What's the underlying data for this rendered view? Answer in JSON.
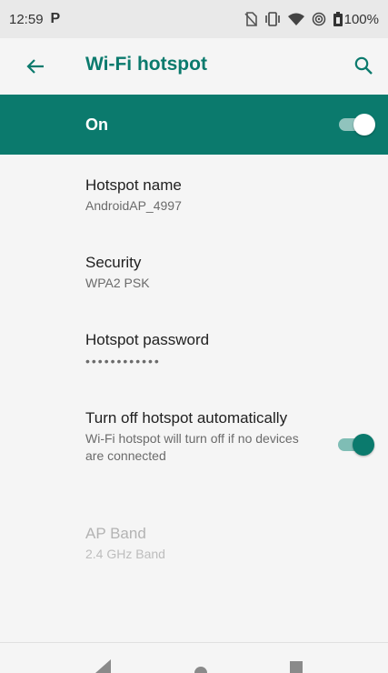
{
  "status_bar": {
    "time": "12:59",
    "notification_glyph": "P",
    "battery_text": "100%",
    "icons": [
      "no-sim-icon",
      "vibrate-icon",
      "wifi-icon",
      "hotspot-icon",
      "battery-icon"
    ]
  },
  "app_bar": {
    "title": "Wi-Fi hotspot",
    "back_icon": "arrow-back-icon",
    "search_icon": "search-icon"
  },
  "master_switch": {
    "label": "On",
    "checked": true
  },
  "preferences": {
    "hotspot_name": {
      "title": "Hotspot name",
      "summary": "AndroidAP_4997"
    },
    "security": {
      "title": "Security",
      "summary": "WPA2 PSK"
    },
    "password": {
      "title": "Hotspot password",
      "summary": "••••••••••••"
    },
    "auto_off": {
      "title": "Turn off hotspot automatically",
      "summary": "Wi-Fi hotspot will turn off if no devices are connected",
      "checked": true
    },
    "ap_band": {
      "title": "AP Band",
      "summary": "2.4 GHz Band",
      "enabled": false
    }
  },
  "nav_bar": {
    "icons": [
      "nav-back-icon",
      "nav-home-icon",
      "nav-recents-icon"
    ]
  },
  "colors": {
    "accent": "#0b7a6d",
    "background": "#f5f5f5",
    "status_bar": "#e9e9e9"
  }
}
